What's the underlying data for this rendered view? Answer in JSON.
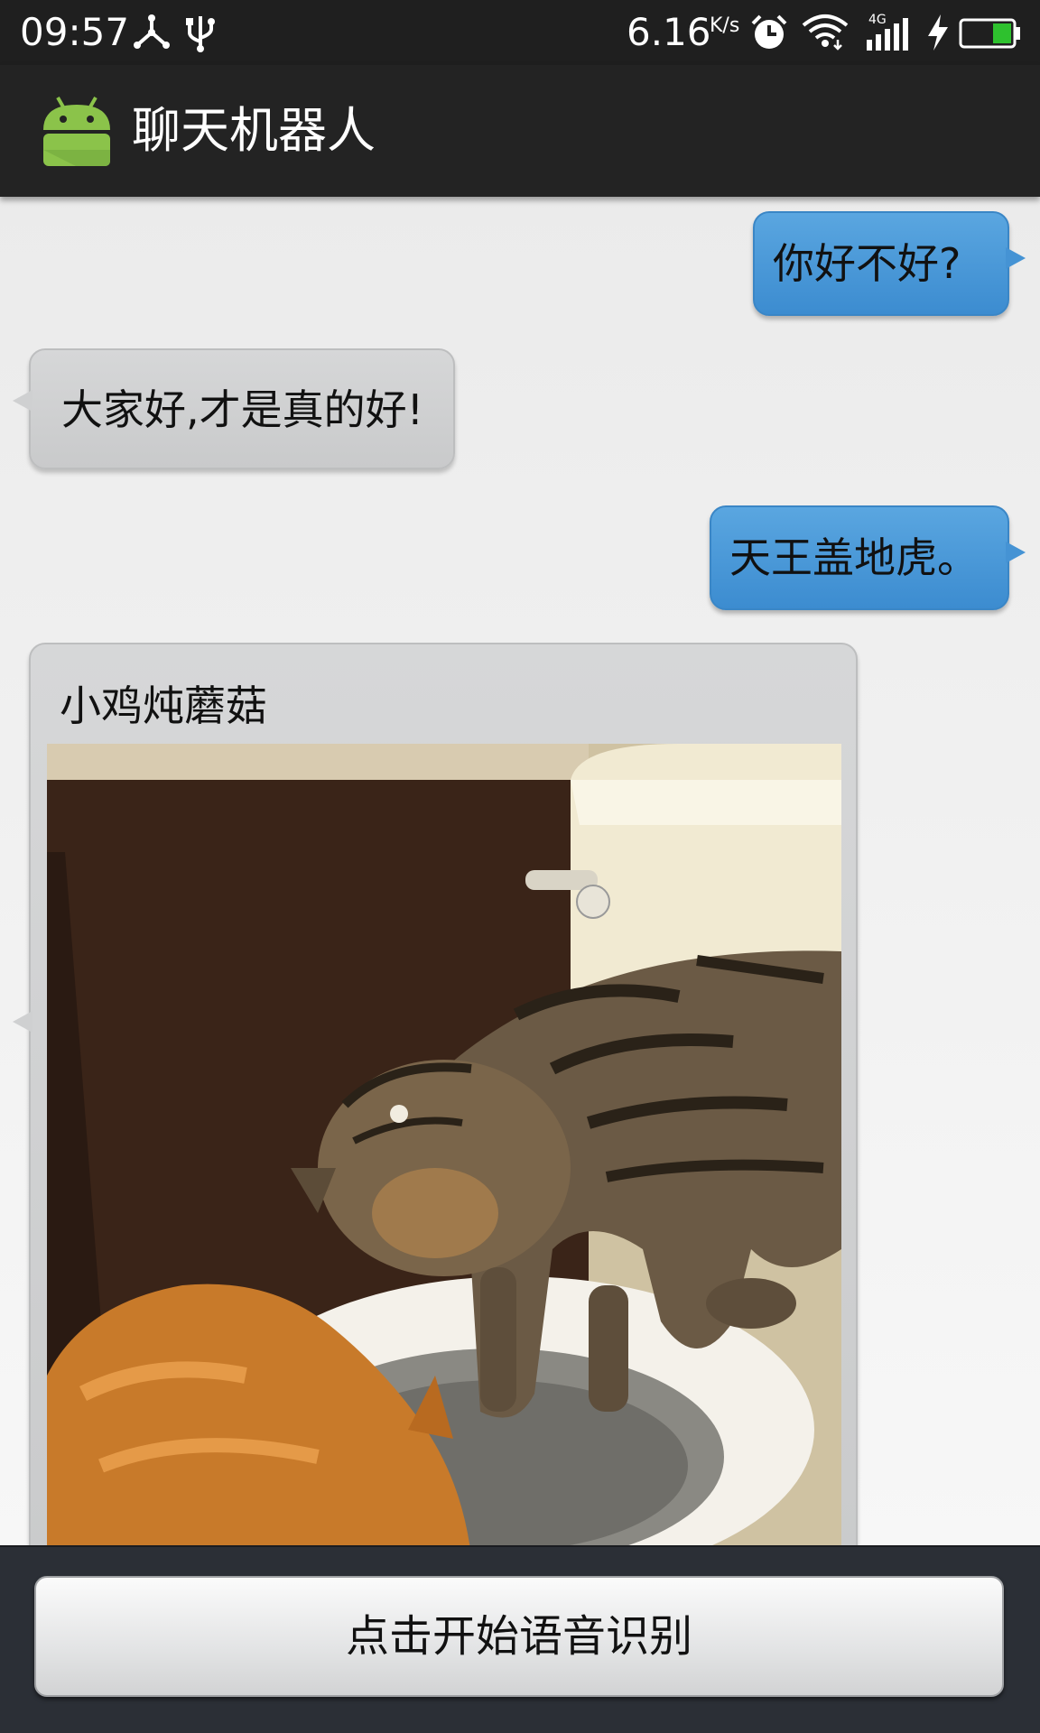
{
  "status_bar": {
    "time": "09:57",
    "network_speed": "6.16",
    "speed_unit": "K/s",
    "network_type": "4G",
    "icons": [
      "network-share-icon",
      "usb-icon",
      "alarm-icon",
      "wifi-icon",
      "signal-icon",
      "charging-icon",
      "battery-icon"
    ]
  },
  "action_bar": {
    "title": "聊天机器人",
    "logo": "android-robot-icon"
  },
  "messages": [
    {
      "direction": "outgoing",
      "text": "你好不好?"
    },
    {
      "direction": "incoming",
      "text": "大家好,才是真的好!"
    },
    {
      "direction": "outgoing",
      "text": "天王盖地虎。"
    },
    {
      "direction": "incoming",
      "type": "image-card",
      "title": "小鸡炖蘑菇",
      "image": "photo of cats drinking from a toilet"
    }
  ],
  "bottom_bar": {
    "voice_button_label": "点击开始语音识别"
  },
  "colors": {
    "outgoing_bubble": "#4a98d8",
    "incoming_bubble": "#cfd0d1",
    "action_bar": "#232323",
    "battery_level": "#2ec12e",
    "android_green": "#8bc34a"
  }
}
